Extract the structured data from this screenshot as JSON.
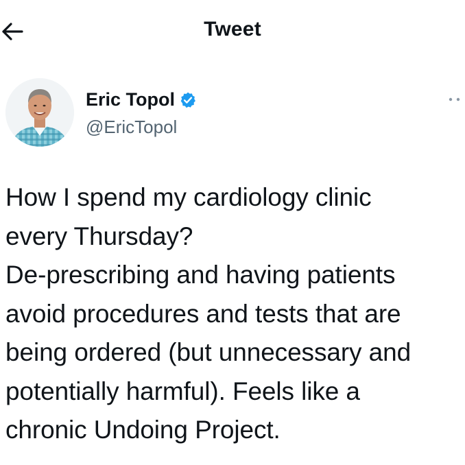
{
  "header": {
    "title": "Tweet",
    "back_icon": "arrow-left-icon"
  },
  "author": {
    "name": "Eric Topol",
    "handle": "@EricTopol",
    "verified": true,
    "verified_color": "#1d9bf0",
    "avatar_icon": "profile-photo"
  },
  "tweet": {
    "text": "How I spend my cardiology clinic\nevery Thursday?\nDe-prescribing and having patients\navoid procedures and tests that are\nbeing ordered (but unnecessary and\npotentially harmful). Feels like a\nchronic Undoing Project."
  },
  "colors": {
    "text_primary": "#0f1419",
    "text_secondary": "#536471",
    "accent": "#1d9bf0"
  }
}
